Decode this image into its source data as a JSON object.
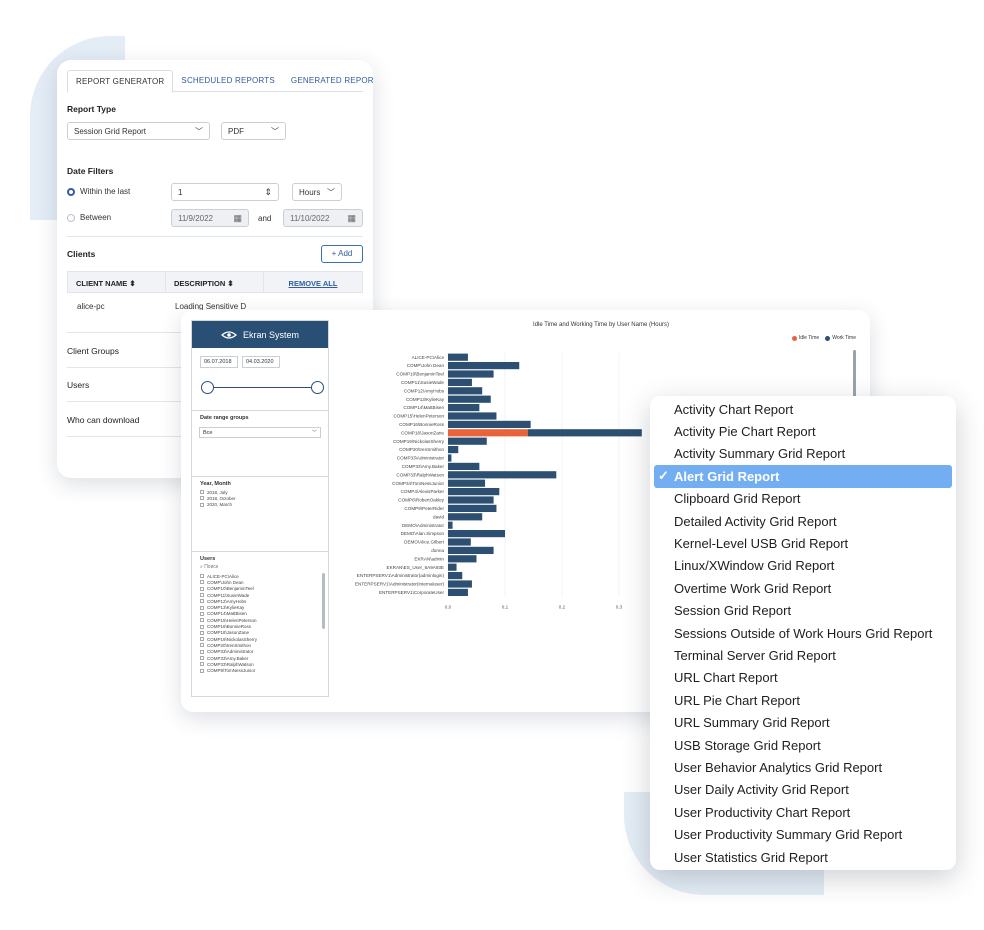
{
  "report_generator": {
    "tabs": [
      "REPORT GENERATOR",
      "SCHEDULED REPORTS",
      "GENERATED REPORTS"
    ],
    "report_type_label": "Report Type",
    "report_type_value": "Session Grid Report",
    "format_value": "PDF",
    "date_filters_label": "Date Filters",
    "within_label": "Within the last",
    "within_value": "1",
    "hours_value": "Hours",
    "between_label": "Between",
    "date_from": "11/9/2022",
    "and_label": "and",
    "date_to": "11/10/2022",
    "clients_label": "Clients",
    "add_label": "+ Add",
    "col_client_name": "CLIENT NAME ⬍",
    "col_description": "DESCRIPTION ⬍",
    "remove_all": "REMOVE ALL",
    "row_client": "alice-pc",
    "row_description": "Loading Sensitive D",
    "client_groups": "Client Groups",
    "users": "Users",
    "who_can_download": "Who can download"
  },
  "dashboard": {
    "brand": "Ekran System",
    "date_start": "06.07.2018",
    "date_end": "04.03.2020",
    "date_range_groups_label": "Date range groups",
    "date_range_groups_value": "Все",
    "year_month_label": "Year, Month",
    "year_month_items": [
      "2018, July",
      "2018, October",
      "2020, March"
    ],
    "users_label": "Users",
    "search_placeholder": "Поиск",
    "user_list": [
      "ALICE-PC\\Alice",
      "COMP\\John Dean",
      "COMP10\\BenjaminTeel",
      "COMP11\\SusieWade",
      "COMP12\\AmyHobs",
      "COMP13\\KylieKay",
      "COMP14\\MattBisen",
      "COMP15\\HelenPeterson",
      "COMP16\\BonnieRoss",
      "COMP18\\JasonZane",
      "COMP19\\NickolasSherry",
      "COMP20\\IrenSmithon",
      "COMP33\\Administrator",
      "COMP33\\Amy.Baker",
      "COMP33\\RalphWatson",
      "COMP8\\TomNessJunior"
    ]
  },
  "chart_data": {
    "type": "bar",
    "title": "Idle Time and Working Time by User Name (Hours)",
    "orientation": "horizontal",
    "stacked": true,
    "categories": [
      "ALICE-PC\\Alice",
      "COMP\\John Dean",
      "COMP10\\BenjaminTeel",
      "COMP11\\SusieWade",
      "COMP12\\AmyHobs",
      "COMP13\\KylieKay",
      "COMP14\\MattBisen",
      "COMP15\\HelenPeterson",
      "COMP16\\BonnieRoss",
      "COMP18\\JasonZane",
      "COMP19\\NickolasSherry",
      "COMP20\\IrenSmithon",
      "COMP33\\Administrator",
      "COMP33\\Amy.Baker",
      "COMP33\\RalphWatson",
      "COMP34\\TomNessJunior",
      "COMP4\\AlexisParker",
      "COMP6\\RobertOakley",
      "COMP9\\PeterRider",
      "david",
      "DEMO\\Administrator",
      "DEMO\\Alan.Simpson",
      "DEMO\\Alice.Gilbert",
      "donna",
      "EKRAN\\admin",
      "EKRAN\\ES_User_6A9A93E",
      "ENTERPSERV1\\Administrator(adminlogin)",
      "ENTERPSERV1\\Administrator(internaluser)",
      "ENTERPSERV1\\CorporateUser"
    ],
    "series": [
      {
        "name": "Idle Time",
        "color": "#e8633a",
        "values": [
          0,
          0,
          0,
          0,
          0,
          0,
          0,
          0,
          0,
          0.14,
          0,
          0,
          0,
          0,
          0,
          0,
          0,
          0,
          0,
          0,
          0,
          0,
          0,
          0,
          0,
          0,
          0,
          0,
          0
        ]
      },
      {
        "name": "Work Time",
        "color": "#2d4f72",
        "values": [
          0.035,
          0.125,
          0.08,
          0.042,
          0.06,
          0.075,
          0.055,
          0.085,
          0.145,
          0.2,
          0.068,
          0.018,
          0.006,
          0.055,
          0.19,
          0.065,
          0.09,
          0.08,
          0.085,
          0.06,
          0.008,
          0.1,
          0.04,
          0.08,
          0.05,
          0.015,
          0.025,
          0.042,
          0.035
        ]
      }
    ],
    "x_ticks": [
      "0,0",
      "0,1",
      "0,2",
      "0,3"
    ],
    "xlim": [
      0,
      0.36
    ],
    "legend_position": "top-right"
  },
  "dropdown": {
    "selected_index": 3,
    "items": [
      "Activity Chart Report",
      "Activity Pie Chart Report",
      "Activity Summary Grid Report",
      "Alert Grid Report",
      "Clipboard Grid Report",
      "Detailed Activity Grid Report",
      "Kernel-Level USB Grid Report",
      "Linux/XWindow Grid Report",
      "Overtime Work Grid Report",
      "Session Grid Report",
      "Sessions Outside of Work Hours Grid Report",
      "Terminal Server Grid Report",
      "URL Chart Report",
      "URL Pie Chart Report",
      "URL Summary Grid Report",
      "USB Storage Grid Report",
      "User Behavior Analytics Grid Report",
      "User Daily Activity Grid Report",
      "User Productivity Chart Report",
      "User Productivity Summary Grid Report",
      "User Statistics Grid Report"
    ]
  }
}
